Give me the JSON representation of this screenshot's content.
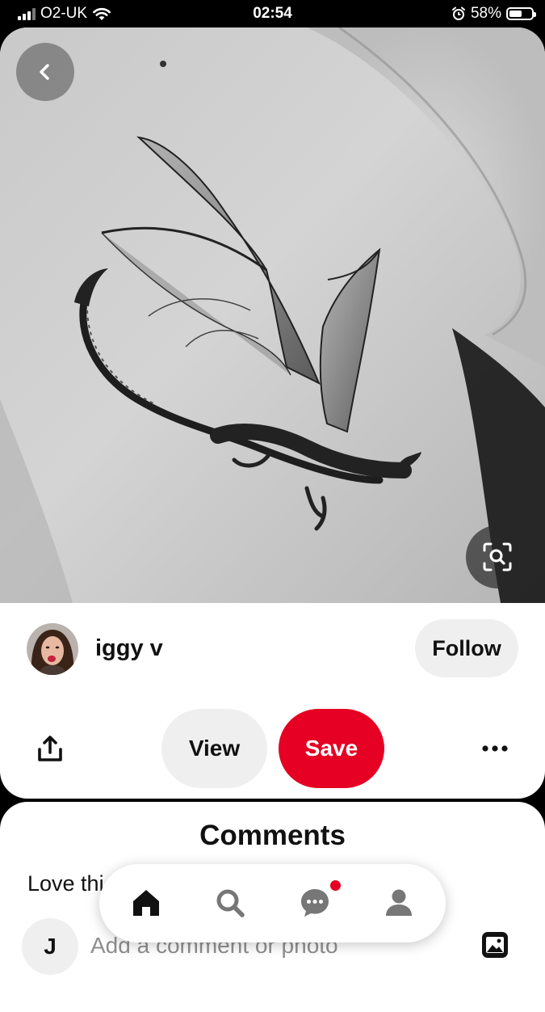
{
  "status_bar": {
    "carrier": "O2-UK",
    "time": "02:54",
    "battery_percent": "58%",
    "battery_level": 0.58,
    "icons": [
      "signal-icon",
      "wifi-icon",
      "alarm-icon",
      "battery-icon"
    ]
  },
  "pin": {
    "image_alt": "Black and grey dragon tattoo on a ribcage",
    "icons": [
      "back-arrow-icon",
      "visual-search-icon"
    ]
  },
  "author": {
    "name": "iggy v",
    "follow_label": "Follow"
  },
  "actions": {
    "view_label": "View",
    "save_label": "Save",
    "icons": [
      "share-icon",
      "more-icon"
    ]
  },
  "colors": {
    "save_red": "#e60023",
    "button_grey": "#efefef",
    "text": "#111111"
  },
  "comments": {
    "title": "Comments",
    "first_comment_visible": "Love thi",
    "user_initial": "J",
    "input_placeholder": "Add a comment or photo",
    "icons": [
      "photo-icon"
    ]
  },
  "bottom_nav": {
    "items": [
      "home-icon",
      "search-icon",
      "messages-icon",
      "profile-icon"
    ],
    "active": "home-icon",
    "messages_has_notification": true
  }
}
